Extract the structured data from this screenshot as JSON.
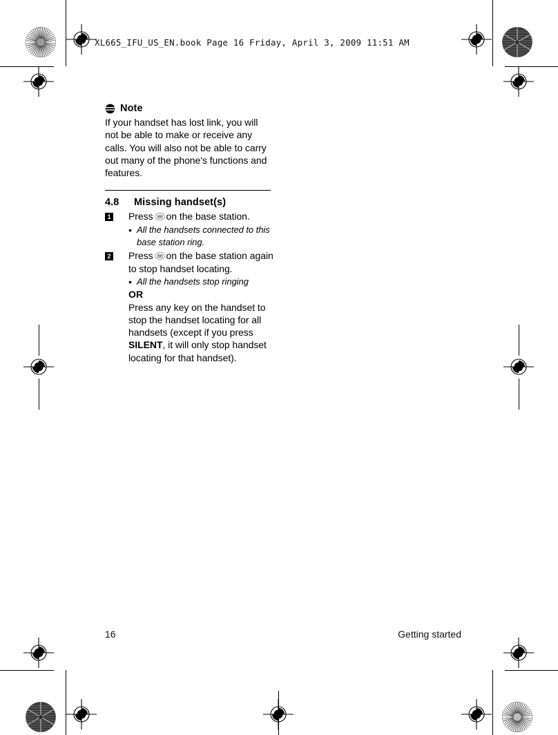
{
  "page": {
    "header_slug": "XL665_IFU_US_EN.book  Page 16  Friday, April 3, 2009  11:51 AM",
    "background": "#ffffff",
    "ink": "#000000"
  },
  "note": {
    "icon": "note-icon",
    "title": "Note",
    "text": "If your handset has lost link, you will not be able to make or receive any calls. You will also not be able to carry out many of the phone's functions and features."
  },
  "section": {
    "number": "4.8",
    "title": "Missing handset(s)",
    "steps": [
      {
        "marker": "1",
        "text_before_icon": "Press",
        "icon": "paging-key-icon",
        "text_after_icon": "on the base station.",
        "bullets": [
          {
            "dot": "•",
            "text": "All the handsets connected to this base station ring."
          }
        ]
      },
      {
        "marker": "2",
        "text_before_icon": "Press",
        "icon": "paging-key-icon",
        "text_after_icon": "on the base station again to stop handset locating.",
        "bullets": [
          {
            "dot": "•",
            "text": "All the handsets stop ringing"
          }
        ],
        "or_label": "OR",
        "or_text_1": "Press any key on the handset to stop the handset locating for all handsets (except if you press ",
        "or_emphasis": "SILENT",
        "or_text_2": ", it will only stop handset locating for that handset)."
      }
    ]
  },
  "footer": {
    "page_number": "16",
    "section_label": "Getting started"
  },
  "print_marks": {
    "registration_label": "registration-target",
    "rosette_label": "color-rosette",
    "trim_label": "trim-line"
  }
}
